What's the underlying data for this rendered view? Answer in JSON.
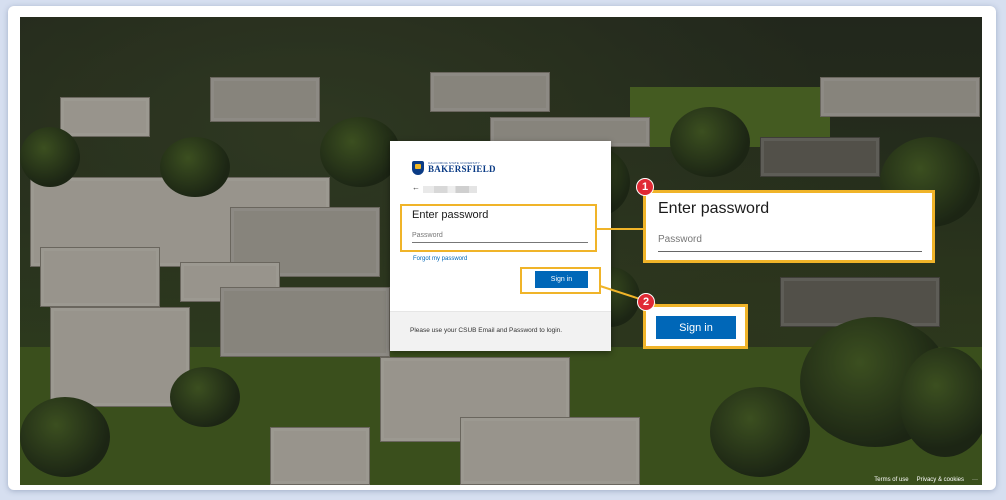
{
  "login": {
    "logo_small": "CALIFORNIA STATE UNIVERSITY",
    "logo_big": "BAKERSFIELD",
    "back_arrow": "←",
    "title": "Enter password",
    "password_placeholder": "Password",
    "forgot_link": "Forgot my password",
    "sign_in_label": "Sign in",
    "footer_note": "Please use your CSUB Email and Password to login."
  },
  "callouts": {
    "step1": {
      "number": "1",
      "title": "Enter password",
      "placeholder": "Password"
    },
    "step2": {
      "number": "2",
      "label": "Sign in"
    }
  },
  "page_footer": {
    "terms": "Terms of use",
    "privacy": "Privacy & cookies",
    "more": "···"
  },
  "colors": {
    "accent_callout": "#f0b429",
    "sign_in_blue": "#0067b8",
    "badge_red": "#e02a35",
    "brand_navy": "#0a3b85"
  }
}
